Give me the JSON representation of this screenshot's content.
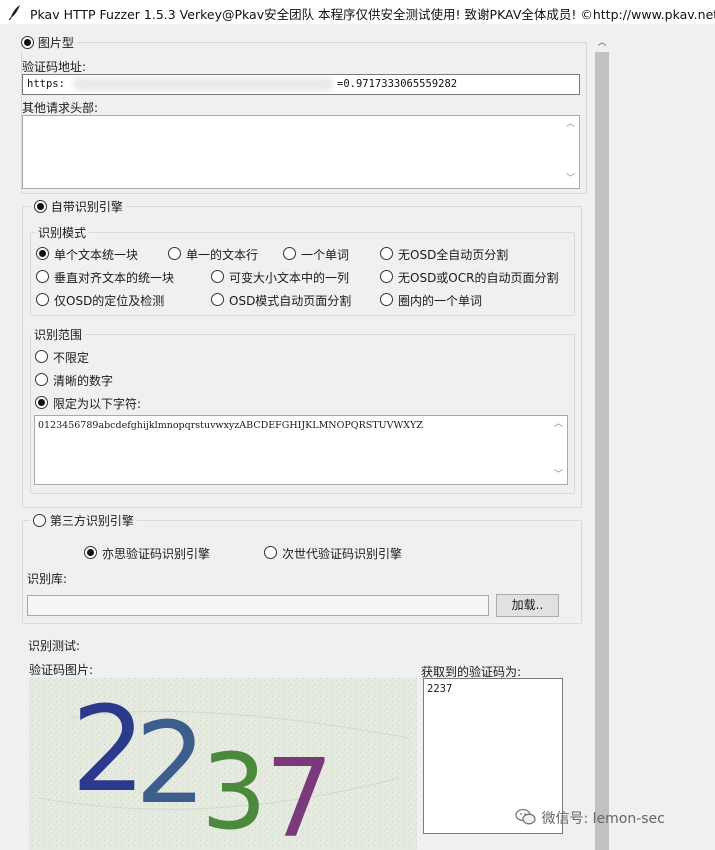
{
  "window": {
    "title": "Pkav HTTP Fuzzer 1.5.3   Verkey@Pkav安全团队  本程序仅供安全测试使用!  致谢PKAV全体成员! ©http://www.pkav.net"
  },
  "image_mode": {
    "label": "图片型",
    "url_label": "验证码地址:",
    "url_prefix": "https:",
    "url_suffix": "=0.9717333065559282",
    "headers_label": "其他请求头部:"
  },
  "builtin_engine": {
    "label": "自带识别引擎",
    "mode_group": "识别模式",
    "modes": [
      "单个文本统一块",
      "单一的文本行",
      "一个单词",
      "无OSD全自动页分割",
      "垂直对齐文本的统一块",
      "可变大小文本中的一列",
      "无OSD或OCR的自动页面分割",
      "仅OSD的定位及检测",
      "OSD模式自动页面分割",
      "圈内的一个单词"
    ],
    "selected_mode": "单个文本统一块",
    "range_group": "识别范围",
    "ranges": [
      "不限定",
      "清晰的数字",
      "限定为以下字符:"
    ],
    "selected_range": "限定为以下字符:",
    "charset": "0123456789abcdefghijklmnopqrstuvwxyzABCDEFGHIJKLMNOPQRSTUVWXYZ"
  },
  "third_party_engine": {
    "label": "第三方识别引擎",
    "options": [
      "亦思验证码识别引擎",
      "次世代验证码识别引擎"
    ],
    "selected": "亦思验证码识别引擎",
    "library_label": "识别库:",
    "library_value": "",
    "load_button": "加载.."
  },
  "test": {
    "label": "识别测试:",
    "image_label": "验证码图片:",
    "result_label": "获取到的验证码为:",
    "result_value": "2237",
    "captcha_digits": [
      {
        "char": "2",
        "color": "#2b3a8c"
      },
      {
        "char": "2",
        "color": "#3b5e8c"
      },
      {
        "char": "3",
        "color": "#4b8a3c"
      },
      {
        "char": "7",
        "color": "#7a3a7a"
      }
    ]
  },
  "watermark": "微信号: lemon-sec",
  "icons": {
    "app": "feather-icon",
    "scroll_up": "chevron-up-icon",
    "scroll_down": "chevron-down-icon",
    "wechat": "wechat-icon"
  }
}
